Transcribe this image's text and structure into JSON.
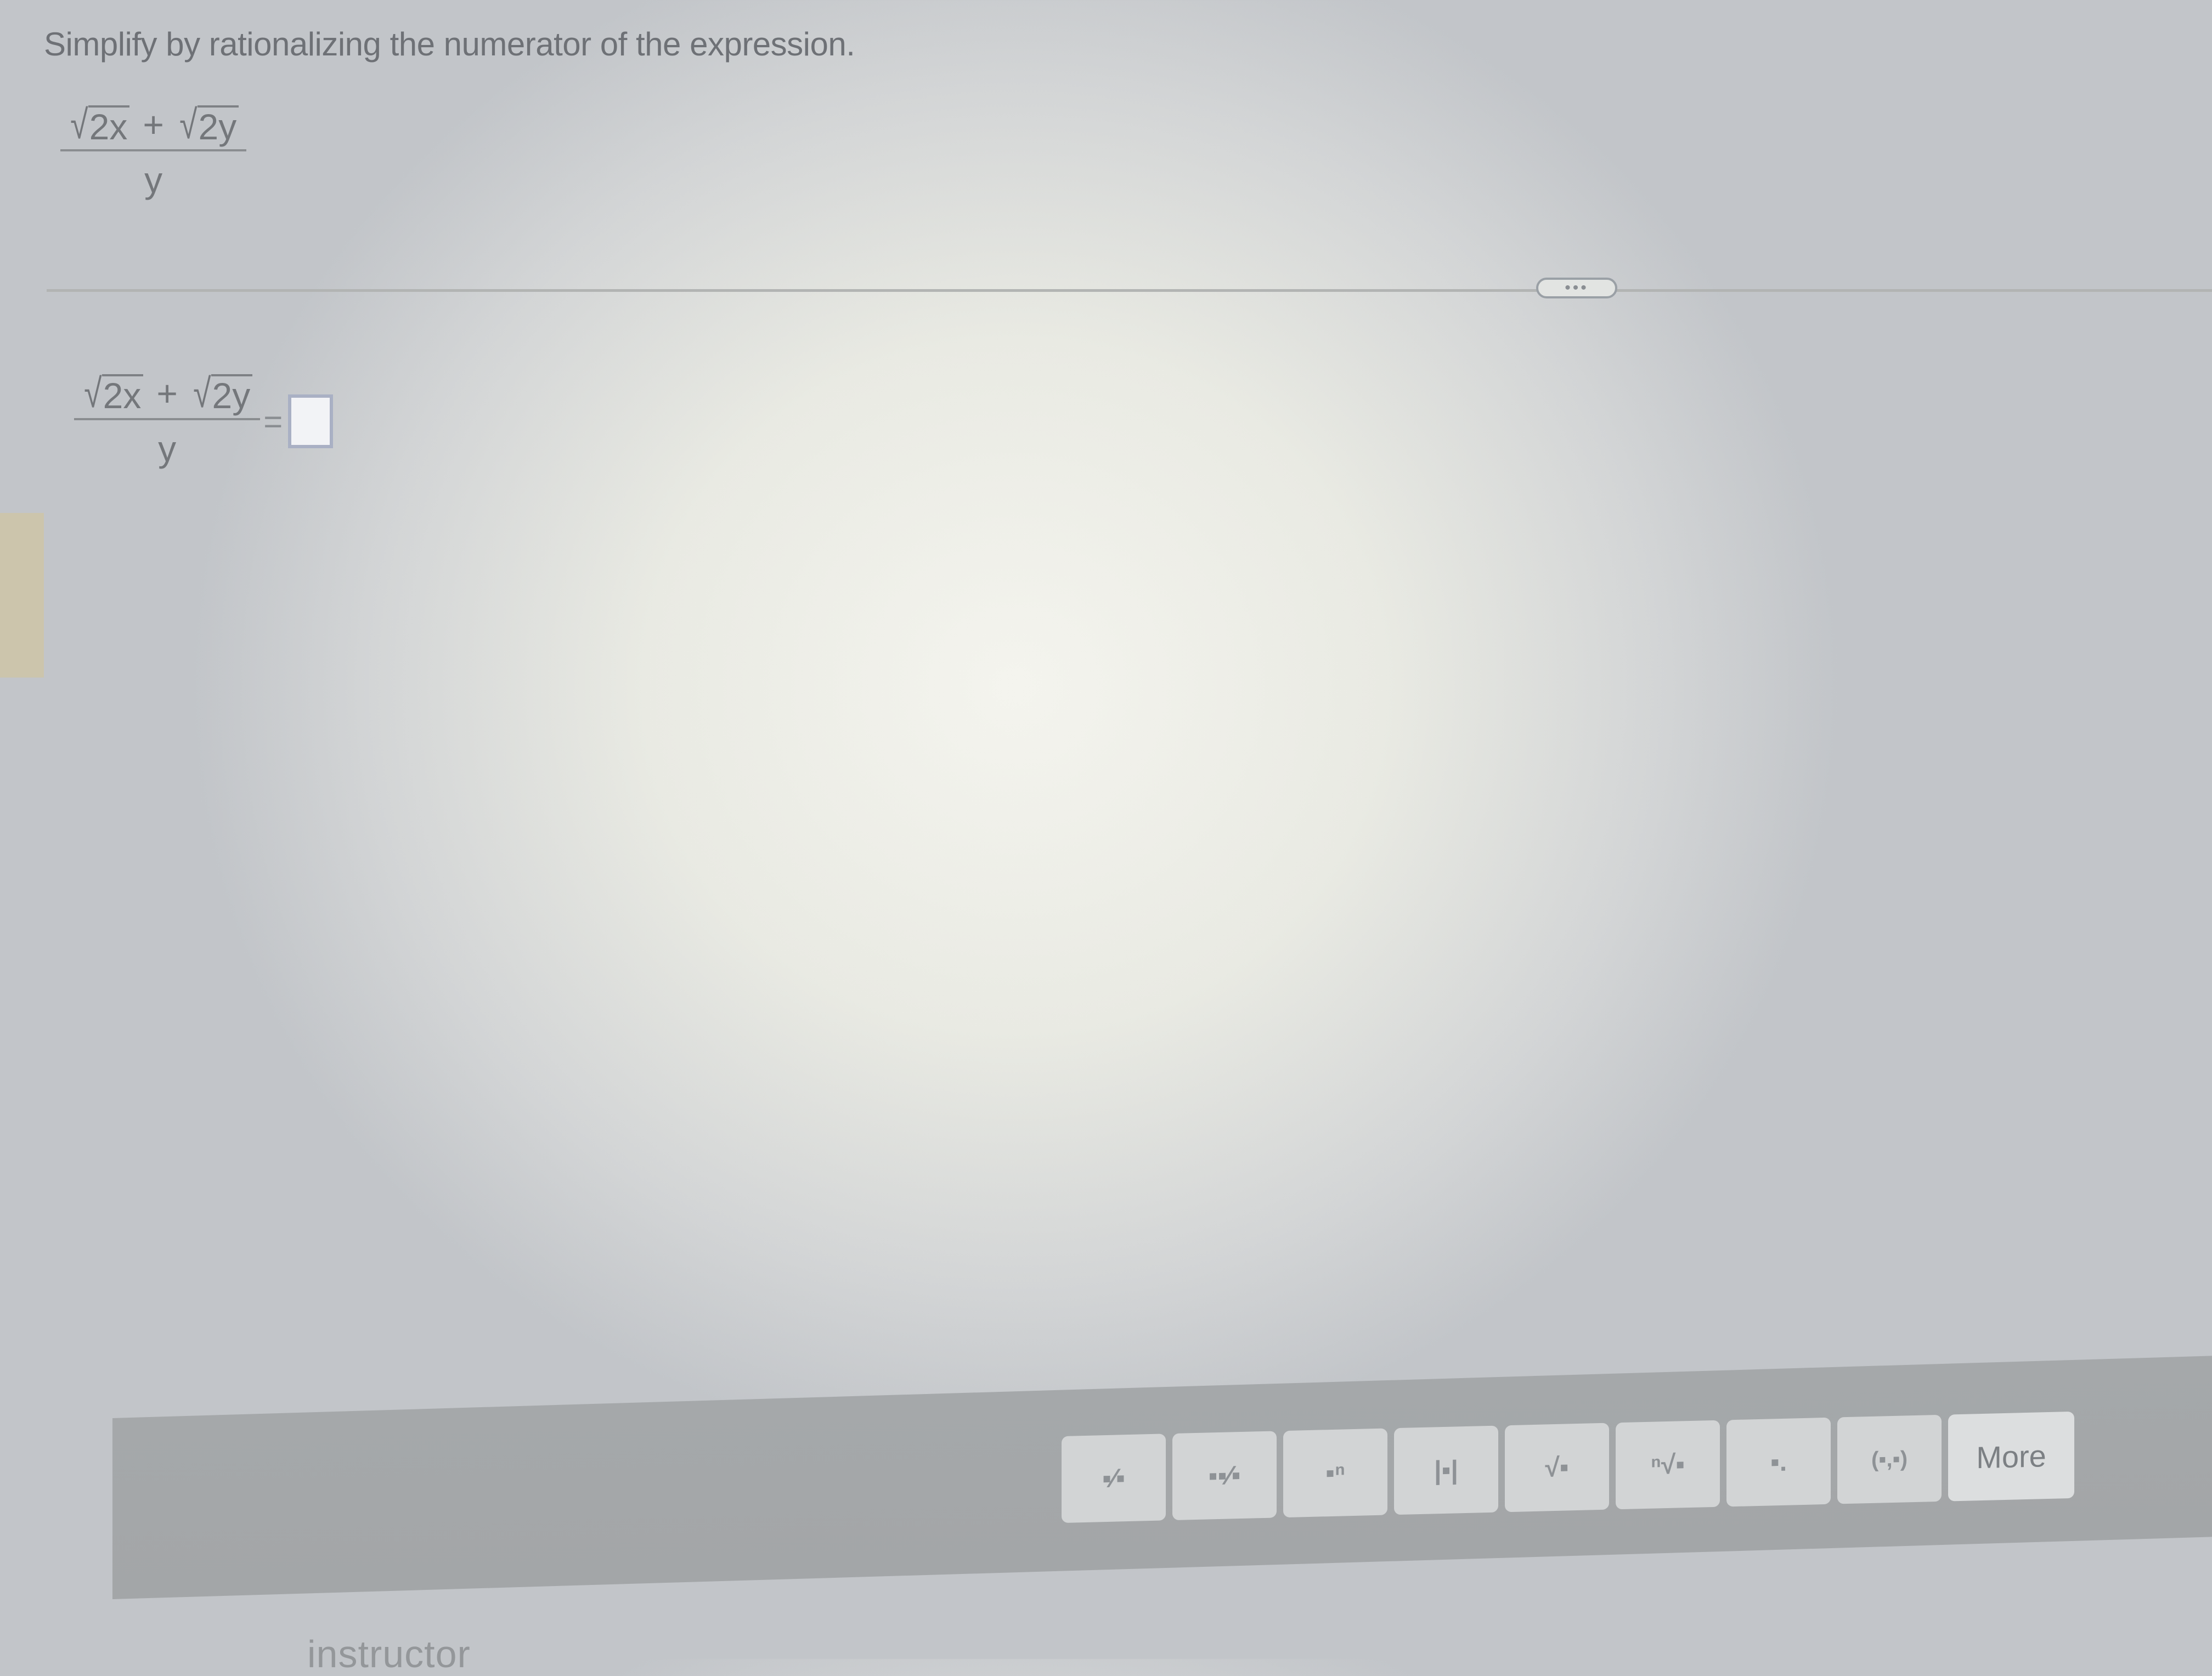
{
  "question": {
    "prompt": "Simplify by rationalizing the numerator of the expression.",
    "expression": {
      "numerator": {
        "term1": "2x",
        "operator": "+",
        "term2": "2y"
      },
      "denominator": "y"
    }
  },
  "answer_line": {
    "expression": {
      "numerator": {
        "term1": "2x",
        "operator": "+",
        "term2": "2y"
      },
      "denominator": "y"
    },
    "equals": "=",
    "input_value": ""
  },
  "divider_button": {
    "label": "•••"
  },
  "toolbar": {
    "buttons": [
      {
        "name": "fraction-button",
        "glyph": "▪⁄▪",
        "icon": "fraction-icon"
      },
      {
        "name": "mixed-number-button",
        "glyph": "▪▪⁄▪",
        "icon": "mixed-number-icon"
      },
      {
        "name": "exponent-button",
        "glyph": "▪ⁿ",
        "icon": "exponent-icon"
      },
      {
        "name": "absolute-value-button",
        "glyph": "|▪|",
        "icon": "absolute-value-icon"
      },
      {
        "name": "square-root-button",
        "glyph": "√▪",
        "icon": "square-root-icon"
      },
      {
        "name": "nth-root-button",
        "glyph": "ⁿ√▪",
        "icon": "nth-root-icon"
      },
      {
        "name": "decimal-button",
        "glyph": "▪.",
        "icon": "decimal-icon"
      },
      {
        "name": "ordered-pair-button",
        "glyph": "(▪,▪)",
        "icon": "ordered-pair-icon"
      }
    ],
    "more_label": "More"
  },
  "footer": {
    "text": "instructor"
  },
  "colors": {
    "answer_box_border": "#a9b0c4",
    "toolbar_bg": "#a5a8aa"
  }
}
